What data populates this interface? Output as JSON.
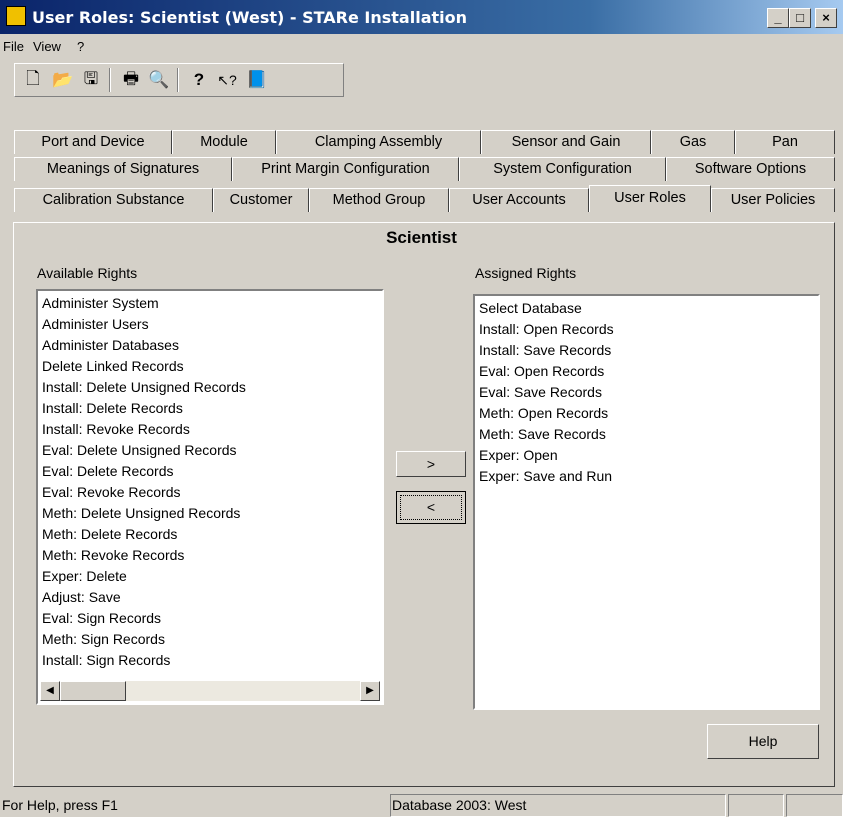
{
  "window": {
    "title": "User Roles: Scientist (West) - STARe Installation",
    "minimize": "_",
    "maximize": "□",
    "close": "×"
  },
  "menu": [
    "File",
    "View",
    "?"
  ],
  "toolbar": {
    "icons": [
      "new-document-icon",
      "open-folder-icon",
      "save-disk-icon",
      "print-icon",
      "print-preview-icon",
      "help-icon",
      "context-help-icon",
      "book-icon"
    ],
    "glyphs": [
      "🗋",
      "📂",
      "🖫",
      "🖶",
      "🔍",
      "?",
      "↖?",
      "📘"
    ]
  },
  "tabs": {
    "row1": [
      "Port and Device",
      "Module",
      "Clamping Assembly",
      "Sensor and Gain",
      "Gas",
      "Pan"
    ],
    "row2": [
      "Meanings of Signatures",
      "Print Margin Configuration",
      "System Configuration",
      "Software Options"
    ],
    "row3": [
      "Calibration Substance",
      "Customer",
      "Method Group",
      "User Accounts",
      "User Roles",
      "User Policies"
    ],
    "active": "User Roles"
  },
  "role_title": "Scientist",
  "available": {
    "label": "Available Rights",
    "items": [
      "Administer System",
      "Administer Users",
      "Administer Databases",
      "Delete Linked Records",
      "Install: Delete Unsigned Records",
      "Install: Delete Records",
      "Install: Revoke Records",
      "Eval: Delete Unsigned Records",
      "Eval: Delete Records",
      "Eval: Revoke Records",
      "Meth: Delete Unsigned Records",
      "Meth: Delete Records",
      "Meth: Revoke Records",
      "Exper: Delete",
      "Adjust: Save",
      "Eval: Sign Records",
      "Meth: Sign Records",
      "Install: Sign Records"
    ]
  },
  "assigned": {
    "label": "Assigned Rights",
    "items": [
      "Select Database",
      "Install: Open Records",
      "Install: Save Records",
      "Eval: Open Records",
      "Eval: Save Records",
      "Meth: Open Records",
      "Meth: Save Records",
      "Exper: Open",
      "Exper: Save and Run"
    ]
  },
  "buttons": {
    "add": ">",
    "remove": "<",
    "help": "Help"
  },
  "status": {
    "help_text": "For Help, press F1",
    "database": "Database 2003: West"
  }
}
